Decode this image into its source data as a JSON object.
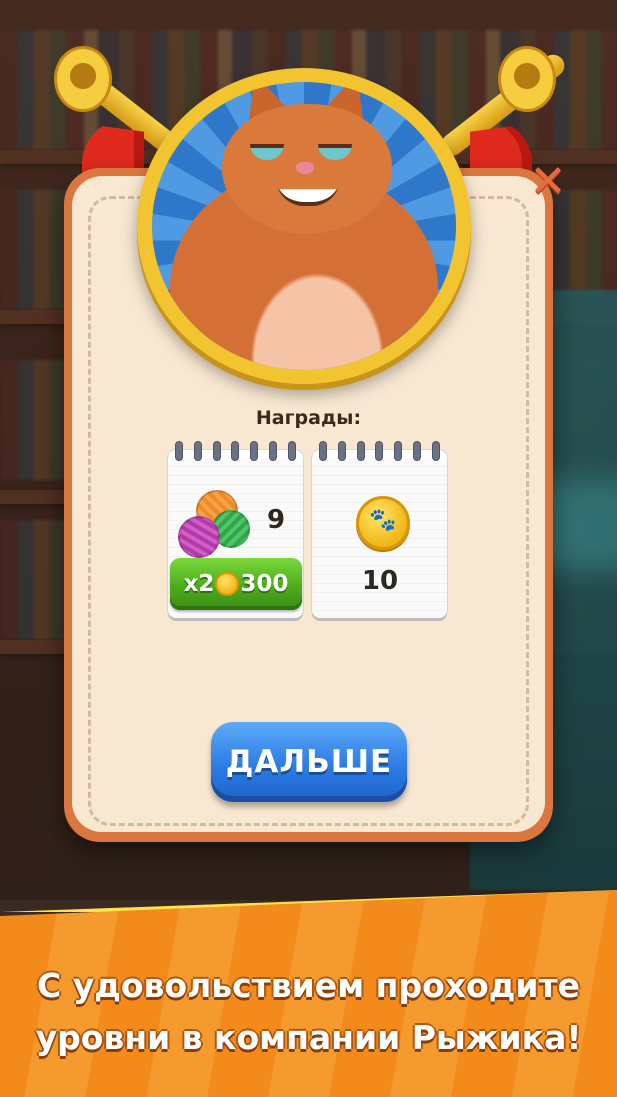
{
  "rewards": {
    "title": "Награды:",
    "items": [
      {
        "icon": "yarn-balls-icon",
        "count": "9"
      },
      {
        "icon": "paw-coin-icon",
        "count": "10"
      }
    ]
  },
  "buy_offer": {
    "multiplier": "x2",
    "price": "300",
    "currency_icon": "paw-coin-icon"
  },
  "next_button": {
    "label": "ДАЛЬШЕ"
  },
  "close_button": {
    "icon": "close-icon",
    "glyph": "✕"
  },
  "footer": {
    "line1": "С удовольствием проходите",
    "line2": "уровни в компании Рыжика!"
  },
  "colors": {
    "card_frame": "#d9773f",
    "card_fill": "#f8e8d2",
    "next_button": "#2c7ce6",
    "buy_button": "#4dab1c",
    "footer": "#f28a1c"
  }
}
